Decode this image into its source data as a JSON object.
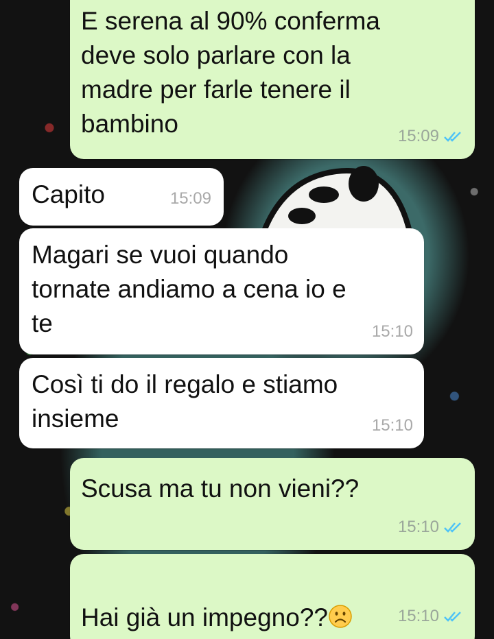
{
  "chat": {
    "messages": [
      {
        "text": "E serena al 90% conferma\ndeve solo parlare con la\nmadre per farle tenere il\nbambino",
        "time": "15:09",
        "direction": "outgoing",
        "status": "read-double-check"
      },
      {
        "text": "Capito",
        "time": "15:09",
        "direction": "incoming"
      },
      {
        "text": "Magari se vuoi quando\ntornate andiamo a cena io e\nte",
        "time": "15:10",
        "direction": "incoming"
      },
      {
        "text": "Così ti do il regalo e stiamo\ninsieme",
        "time": "15:10",
        "direction": "incoming"
      },
      {
        "text": "Scusa ma tu non vieni??",
        "time": "15:10",
        "direction": "outgoing",
        "status": "read-double-check"
      },
      {
        "text": "Hai già un impegno??",
        "emoji": "frowning-face-icon",
        "time": "15:10",
        "direction": "outgoing",
        "status": "read-double-check"
      }
    ]
  },
  "colors": {
    "outgoing_bubble": "#dcf8c6",
    "incoming_bubble": "#ffffff",
    "read_ticks": "#4fc3f7",
    "timestamp": "#9aa69a"
  }
}
